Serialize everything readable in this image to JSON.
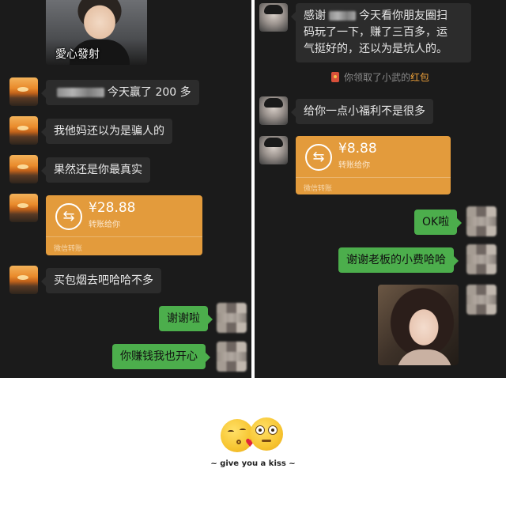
{
  "left_chat": {
    "photo_caption": "愛心發射",
    "messages": [
      {
        "id": "m1",
        "before": "",
        "after": "今天赢了 200 多"
      },
      {
        "id": "m2",
        "text": "我他妈还以为是骗人的"
      },
      {
        "id": "m3",
        "text": "果然还是你最真实"
      },
      {
        "id": "m5",
        "text": "买包烟去吧哈哈不多"
      },
      {
        "id": "m6",
        "text": "谢谢啦"
      },
      {
        "id": "m7",
        "text": "你赚钱我也开心"
      }
    ],
    "transfer": {
      "icon": "transfer-arrows-icon",
      "amount": "¥28.88",
      "subtitle": "转账给你",
      "footer": "微信转账"
    }
  },
  "right_chat": {
    "messages": [
      {
        "id": "r1",
        "lead": "感谢",
        "line1": "今天看你朋友圈扫",
        "line2": "码玩了一下，赚了三百多，运",
        "line3": "气挺好的，还以为是坑人的。"
      },
      {
        "id": "r3",
        "text": "给你一点小福利不是很多"
      },
      {
        "id": "r5",
        "text": "OK啦"
      },
      {
        "id": "r6",
        "text": "谢谢老板的小费哈哈"
      }
    ],
    "system": {
      "icon": "red-packet-icon",
      "text": "你领取了小武的",
      "link": "红包"
    },
    "transfer": {
      "icon": "transfer-arrows-icon",
      "amount": "¥8.88",
      "subtitle": "转账给你",
      "footer": "微信转账"
    }
  },
  "footer": {
    "emoji": [
      "kissing-face-icon",
      "flushed-face-icon"
    ],
    "caption": "~ give you a kiss ~"
  },
  "colors": {
    "chat_bg": "#1b1b1b",
    "received_bubble": "#2c2c2c",
    "sent_bubble": "#4cae4c",
    "transfer_card": "#e39b3c",
    "red_packet_link": "#f0a23a"
  }
}
